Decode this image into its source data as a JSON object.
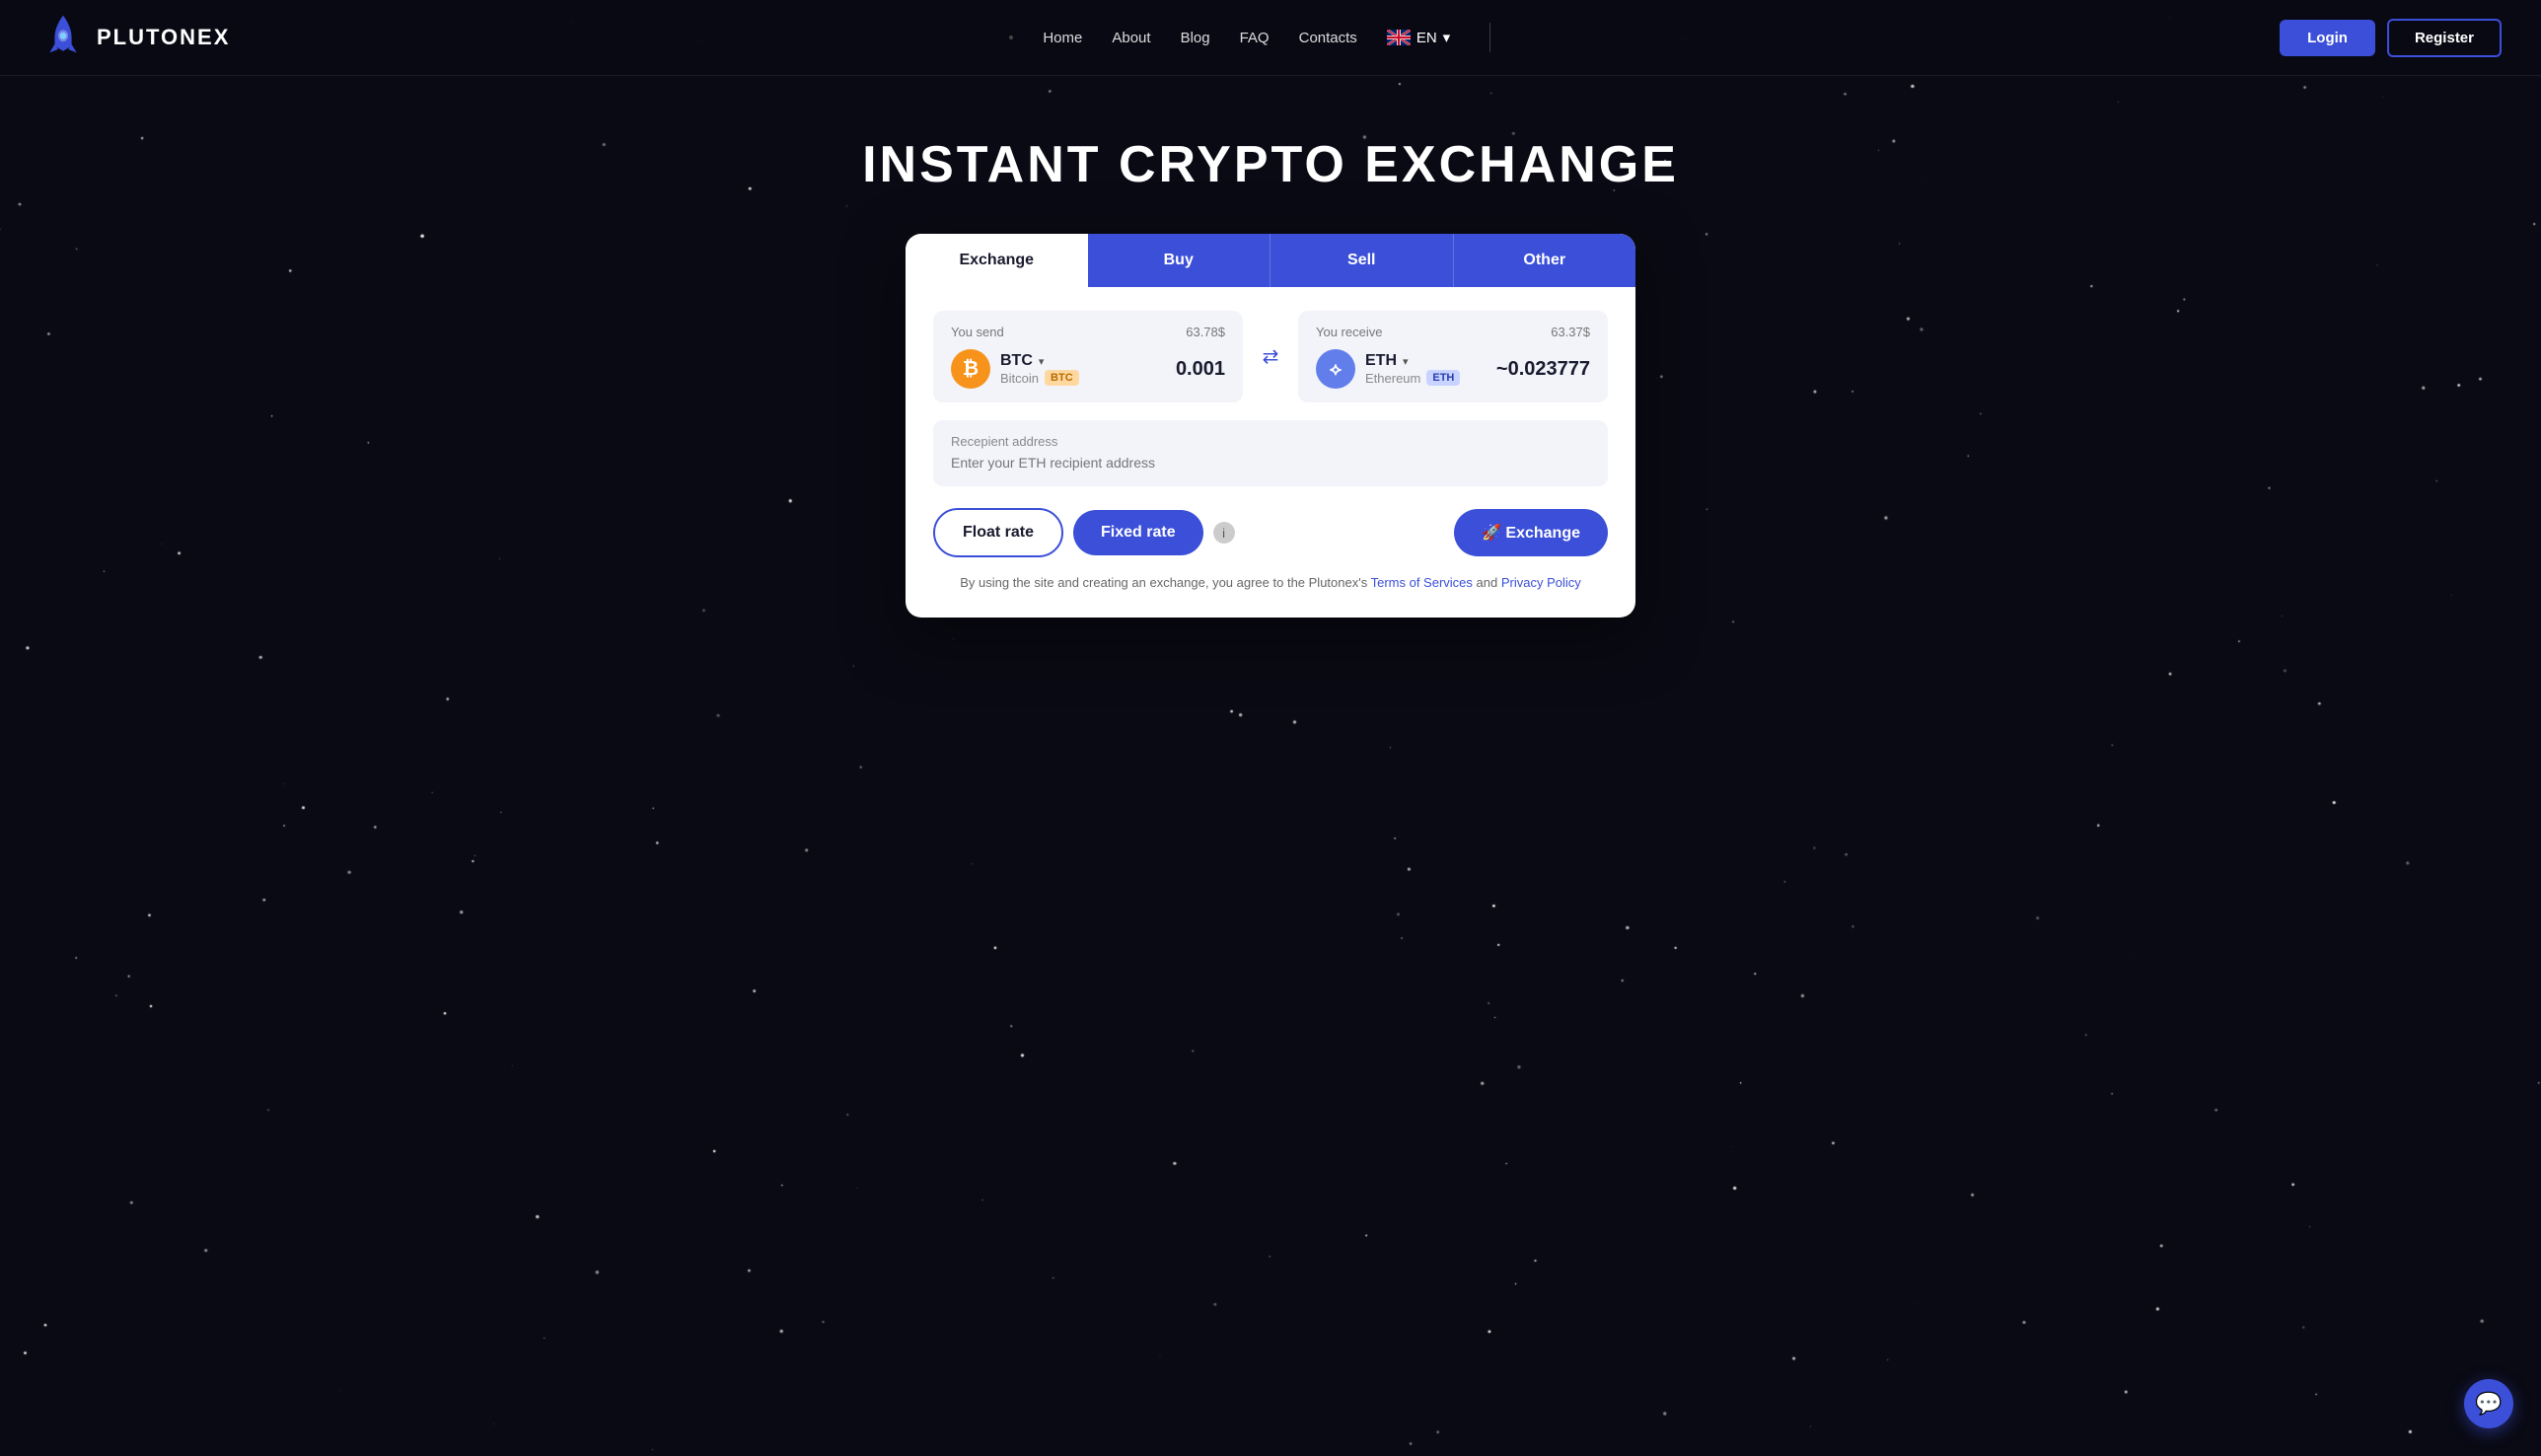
{
  "brand": {
    "name": "PLUTONEX",
    "logoAlt": "Plutonex rocket logo"
  },
  "nav": {
    "links": [
      "Home",
      "About",
      "Blog",
      "FAQ",
      "Contacts"
    ],
    "lang": "EN",
    "loginLabel": "Login",
    "registerLabel": "Register"
  },
  "hero": {
    "title": "INSTANT CRYPTO EXCHANGE"
  },
  "tabs": [
    {
      "id": "exchange",
      "label": "Exchange",
      "active": true
    },
    {
      "id": "buy",
      "label": "Buy"
    },
    {
      "id": "sell",
      "label": "Sell"
    },
    {
      "id": "other",
      "label": "Other"
    }
  ],
  "exchangeWidget": {
    "send": {
      "label": "You send",
      "usdValue": "63.78$",
      "coin": "BTC",
      "coinFull": "Bitcoin",
      "badge": "BTC",
      "amount": "0.001"
    },
    "receive": {
      "label": "You receive",
      "usdValue": "63.37$",
      "coin": "ETH",
      "coinFull": "Ethereum",
      "badge": "ETH",
      "amount": "~0.023777"
    },
    "address": {
      "label": "Recepient address",
      "placeholder": "Enter your ETH recipient address"
    },
    "floatRate": "Float rate",
    "fixedRate": "Fixed rate",
    "exchangeBtn": "🚀 Exchange",
    "termsText": "By using the site and creating an exchange, you agree to the Plutonex's",
    "termsLink": "Terms of Services",
    "andText": "and",
    "privacyLink": "Privacy Policy"
  },
  "chat": {
    "icon": "💬"
  }
}
